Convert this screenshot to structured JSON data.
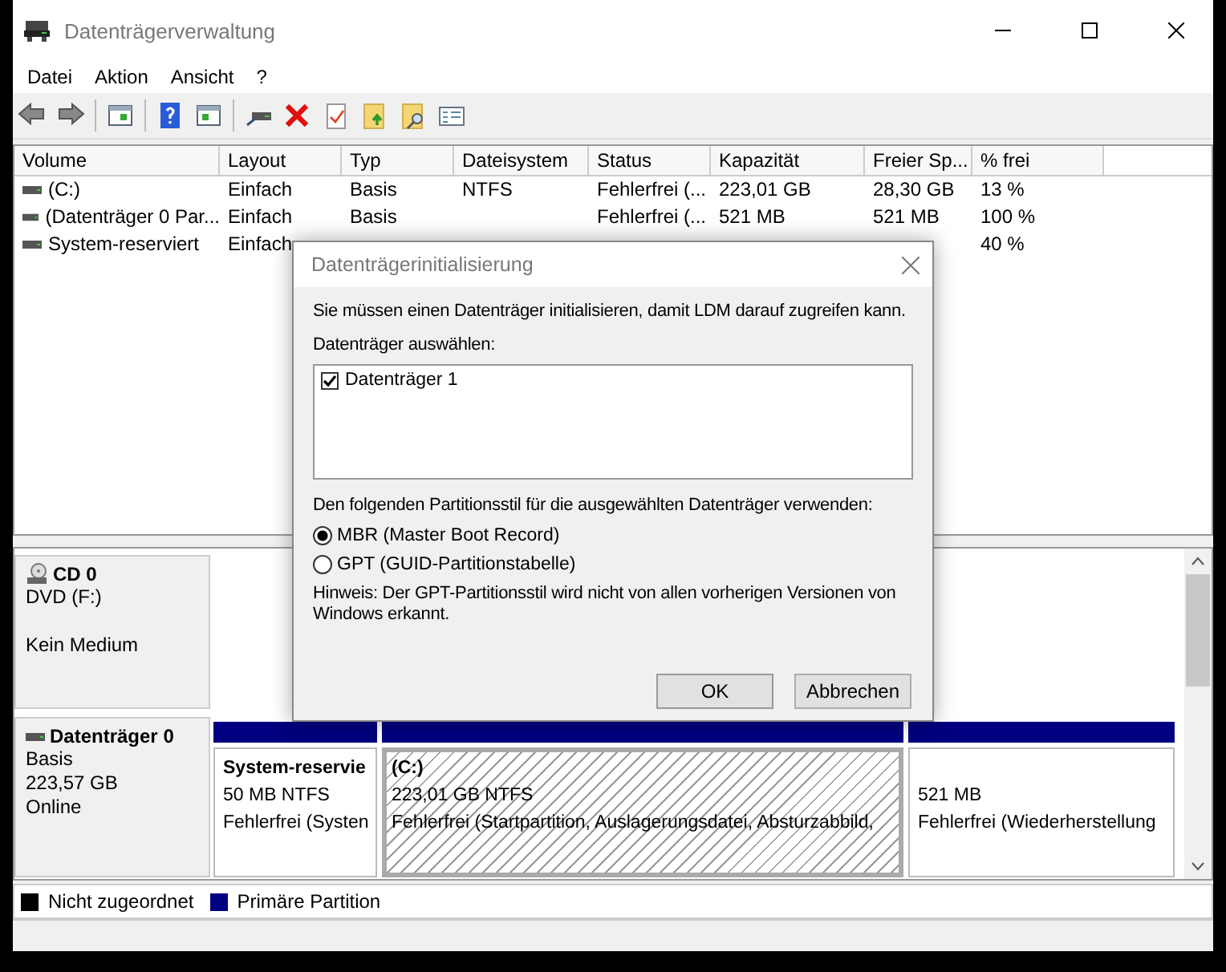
{
  "window": {
    "title": "Datenträgerverwaltung"
  },
  "menu": [
    "Datei",
    "Aktion",
    "Ansicht",
    "?"
  ],
  "volumes": {
    "columns": [
      "Volume",
      "Layout",
      "Typ",
      "Dateisystem",
      "Status",
      "Kapazität",
      "Freier Sp...",
      "% frei"
    ],
    "rows": [
      {
        "cells": [
          "(C:)",
          "Einfach",
          "Basis",
          "NTFS",
          "Fehlerfrei (...",
          "223,01 GB",
          "28,30 GB",
          "13 %"
        ]
      },
      {
        "cells": [
          "(Datenträger 0 Par...",
          "Einfach",
          "Basis",
          null,
          "Fehlerfrei (...",
          "521 MB",
          "521 MB",
          "100 %"
        ]
      },
      {
        "cells": [
          "System-reserviert",
          "Einfach",
          null,
          null,
          null,
          null,
          null,
          "40 %"
        ]
      }
    ]
  },
  "disks": [
    {
      "kind": "cd",
      "name": "CD 0",
      "lines": [
        "DVD (F:)",
        "Kein Medium"
      ]
    },
    {
      "kind": "disk",
      "name": "Datenträger 0",
      "lines": [
        "Basis",
        "223,57 GB",
        "Online"
      ],
      "partitions": [
        {
          "name": "System-reservie",
          "size": "50 MB NTFS",
          "status": "Fehlerfrei (Systen",
          "selected": false
        },
        {
          "name": "(C:)",
          "size": "223,01 GB NTFS",
          "status": "Fehlerfrei (Startpartition, Auslagerungsdatei, Absturzabbild,",
          "selected": true
        },
        {
          "size": "521 MB",
          "status": "Fehlerfrei (Wiederherstellung",
          "selected": false
        }
      ]
    }
  ],
  "legend": [
    {
      "label": "Nicht zugeordnet",
      "color": "#000000"
    },
    {
      "label": "Primäre Partition",
      "color": "#000080"
    }
  ],
  "dialog": {
    "title": "Datenträgerinitialisierung",
    "intro": "Sie müssen einen Datenträger initialisieren, damit LDM darauf zugreifen kann.",
    "select_label": "Datenträger auswählen:",
    "disks": [
      {
        "label": "Datenträger 1",
        "checked": true
      }
    ],
    "style_label": "Den folgenden Partitionsstil für die ausgewählten Datenträger verwenden:",
    "styles": [
      {
        "label": "MBR (Master Boot Record)",
        "selected": true
      },
      {
        "label": "GPT (GUID-Partitionstabelle)",
        "selected": false
      }
    ],
    "note": "Hinweis: Der GPT-Partitionsstil wird nicht von allen vorherigen Versionen von Windows erkannt.",
    "buttons": [
      "OK",
      "Abbrechen"
    ]
  }
}
